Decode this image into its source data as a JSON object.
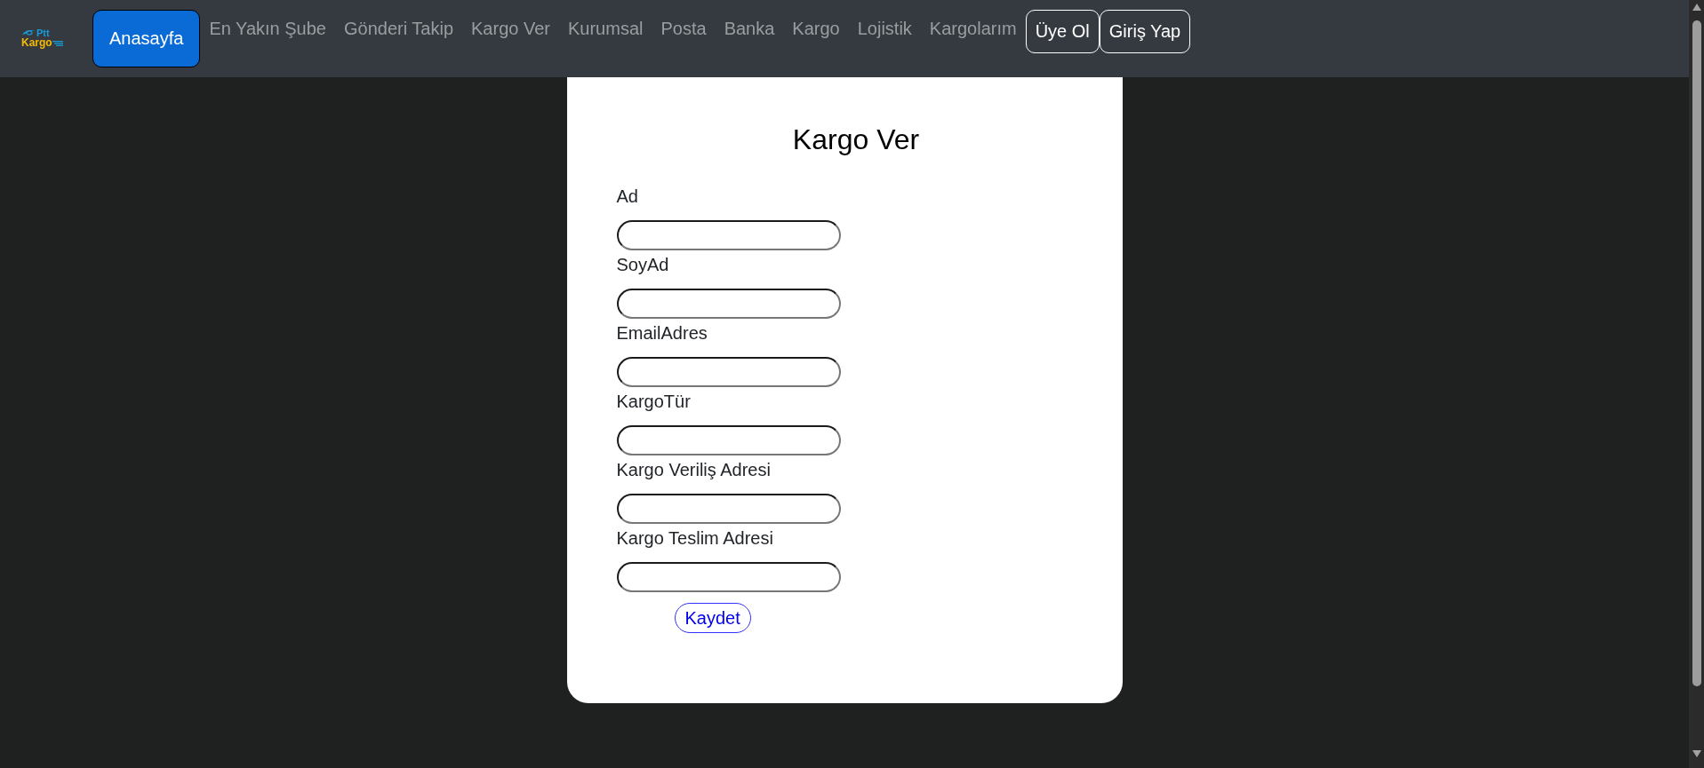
{
  "navbar": {
    "logo": {
      "line_1": "Ptt",
      "line_2": "Kargo"
    },
    "items": [
      {
        "label": "Anasayfa",
        "kind": "primary"
      },
      {
        "label": "En Yakın Şube",
        "kind": "link"
      },
      {
        "label": "Gönderi Takip",
        "kind": "link"
      },
      {
        "label": "Kargo Ver",
        "kind": "link"
      },
      {
        "label": "Kurumsal",
        "kind": "link"
      },
      {
        "label": "Posta",
        "kind": "link"
      },
      {
        "label": "Banka",
        "kind": "link"
      },
      {
        "label": "Kargo",
        "kind": "link"
      },
      {
        "label": "Lojistik",
        "kind": "link"
      },
      {
        "label": "Kargolarım",
        "kind": "link"
      },
      {
        "label": "Üye Ol",
        "kind": "outline"
      },
      {
        "label": "Giriş Yap",
        "kind": "outline"
      }
    ]
  },
  "form": {
    "title": "Kargo Ver",
    "fields": [
      {
        "label": "Ad"
      },
      {
        "label": "SoyAd"
      },
      {
        "label": "EmailAdres"
      },
      {
        "label": "KargoTür"
      },
      {
        "label": "Kargo Veriliş Adresi"
      },
      {
        "label": "Kargo Teslim Adresi"
      }
    ],
    "submit": "Kaydet"
  }
}
